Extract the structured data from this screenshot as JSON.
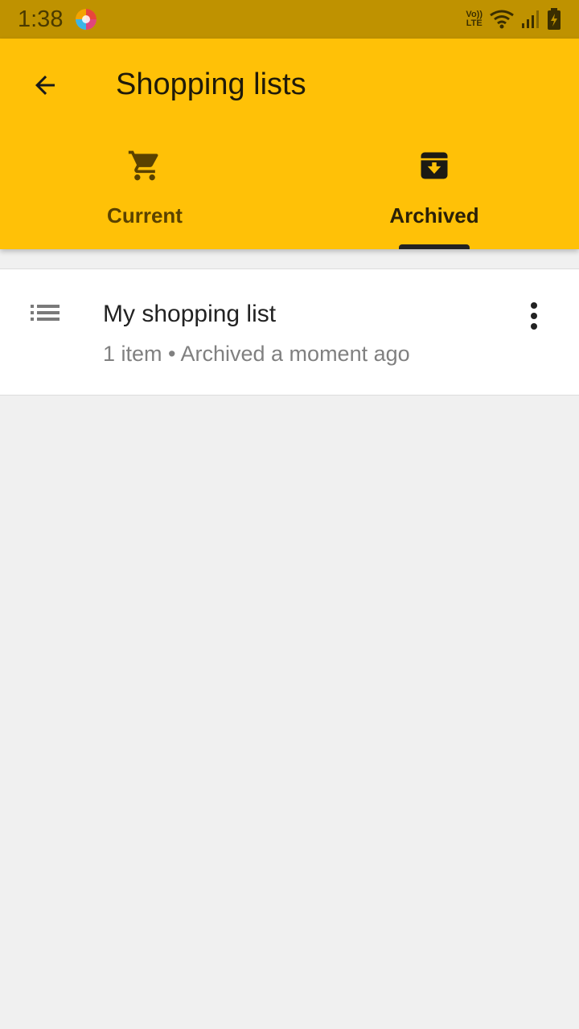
{
  "status_bar": {
    "time": "1:38",
    "volte_top": "Vo))",
    "volte_bottom": "LTE",
    "icons": [
      "app-notification-icon",
      "volte-icon",
      "wifi-icon",
      "signal-icon",
      "battery-charging-icon"
    ]
  },
  "app_bar": {
    "title": "Shopping lists",
    "back_icon": "back-arrow-icon",
    "background_color": "#ffc107",
    "status_color": "#bf9200"
  },
  "tabs": [
    {
      "label": "Current",
      "icon": "cart-icon",
      "selected": false
    },
    {
      "label": "Archived",
      "icon": "archive-icon",
      "selected": true
    }
  ],
  "lists": [
    {
      "title": "My shopping list",
      "subtitle": "1 item • Archived a moment ago",
      "icon": "list-icon",
      "menu_icon": "more-vert-icon"
    }
  ]
}
